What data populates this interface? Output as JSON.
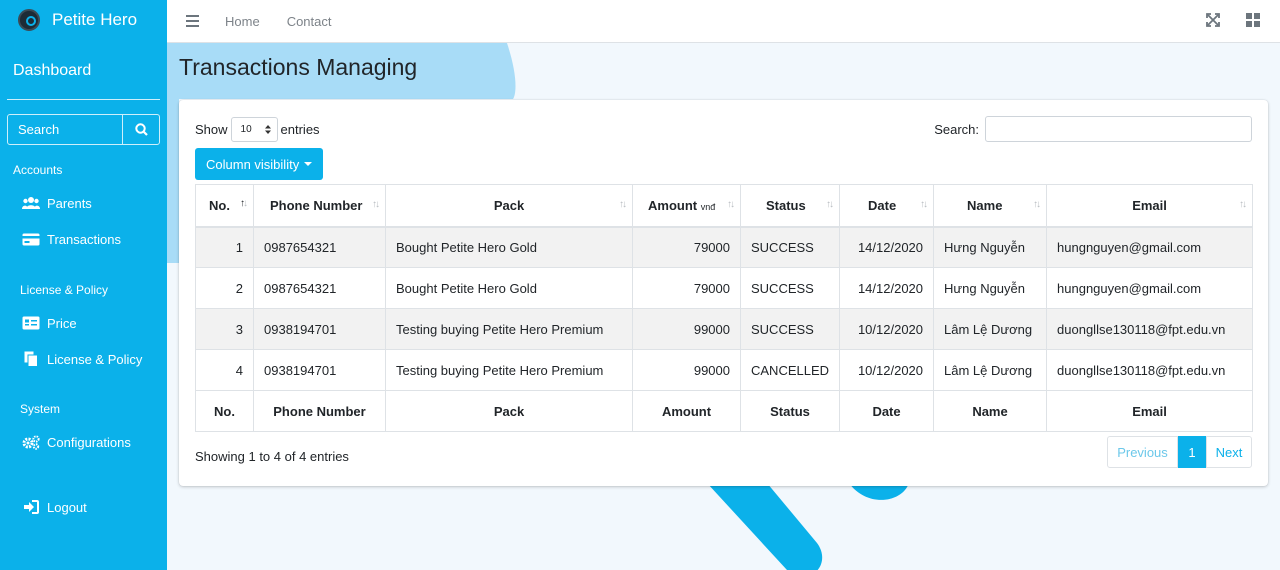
{
  "brand": {
    "name": "Petite Hero"
  },
  "sidebar": {
    "dashboard": "Dashboard",
    "search_placeholder": "Search",
    "sections": [
      {
        "title": "Accounts",
        "items": [
          {
            "label": "Parents",
            "icon": "users-icon"
          },
          {
            "label": "Transactions",
            "icon": "credit-card-icon"
          }
        ]
      },
      {
        "title": "License & Policy",
        "items": [
          {
            "label": "Price",
            "icon": "price-tag-icon"
          },
          {
            "label": "License & Policy",
            "icon": "copy-icon"
          }
        ]
      },
      {
        "title": "System",
        "items": [
          {
            "label": "Configurations",
            "icon": "cogs-icon"
          }
        ]
      }
    ],
    "logout": "Logout"
  },
  "topbar": {
    "home": "Home",
    "contact": "Contact"
  },
  "page": {
    "title": "Transactions Managing"
  },
  "controls": {
    "show_label": "Show",
    "entries_value": "10",
    "entries_label": "entries",
    "search_label": "Search:",
    "column_visibility": "Column visibility"
  },
  "table": {
    "headers": {
      "no": "No.",
      "phone": "Phone Number",
      "pack": "Pack",
      "amount": "Amount",
      "amount_unit": "vnđ",
      "status": "Status",
      "date": "Date",
      "name": "Name",
      "email": "Email"
    },
    "rows": [
      {
        "no": "1",
        "phone": "0987654321",
        "pack": "Bought Petite Hero Gold",
        "amount": "79000",
        "status": "SUCCESS",
        "date": "14/12/2020",
        "name": "Hưng Nguyễn",
        "email": "hungnguyen@gmail.com"
      },
      {
        "no": "2",
        "phone": "0987654321",
        "pack": "Bought Petite Hero Gold",
        "amount": "79000",
        "status": "SUCCESS",
        "date": "14/12/2020",
        "name": "Hưng Nguyễn",
        "email": "hungnguyen@gmail.com"
      },
      {
        "no": "3",
        "phone": "0938194701",
        "pack": "Testing buying Petite Hero Premium",
        "amount": "99000",
        "status": "SUCCESS",
        "date": "10/12/2020",
        "name": "Lâm Lệ Dương",
        "email": "duongllse130118@fpt.edu.vn"
      },
      {
        "no": "4",
        "phone": "0938194701",
        "pack": "Testing buying Petite Hero Premium",
        "amount": "99000",
        "status": "CANCELLED",
        "date": "10/12/2020",
        "name": "Lâm Lệ Dương",
        "email": "duongllse130118@fpt.edu.vn"
      }
    ],
    "footers": {
      "no": "No.",
      "phone": "Phone Number",
      "pack": "Pack",
      "amount": "Amount",
      "status": "Status",
      "date": "Date",
      "name": "Name",
      "email": "Email"
    }
  },
  "footer": {
    "info": "Showing 1 to 4 of 4 entries",
    "previous": "Previous",
    "page": "1",
    "next": "Next"
  },
  "colors": {
    "accent": "#0bb1ea",
    "background": "#f2f8fd"
  }
}
